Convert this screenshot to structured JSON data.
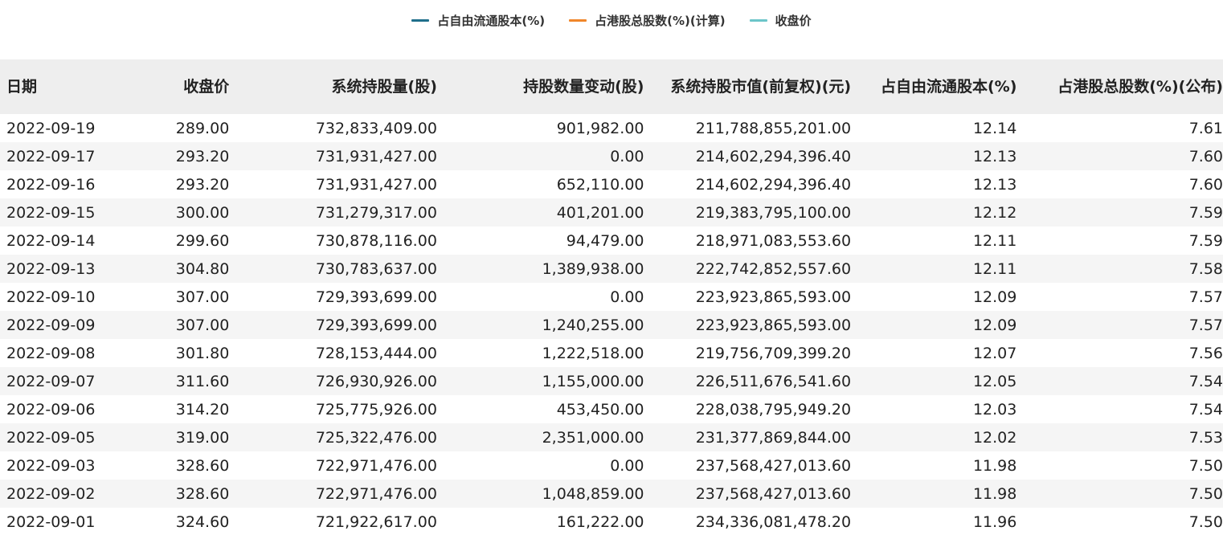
{
  "legend": {
    "items": [
      {
        "label": "占自由流通股本(%)",
        "color": "#1f6f8b"
      },
      {
        "label": "占港股总股数(%)(计算)",
        "color": "#f0862a"
      },
      {
        "label": "收盘价",
        "color": "#6cc5c9"
      }
    ]
  },
  "table": {
    "headers": {
      "date": "日期",
      "close": "收盘价",
      "holding": "系统持股量(股)",
      "change": "持股数量变动(股)",
      "value": "系统持股市值(前复权)(元)",
      "free_float": "占自由流通股本(%)",
      "hk_total": "占港股总股数(%)(公布)"
    },
    "rows": [
      {
        "date": "2022-09-19",
        "close": "289.00",
        "holding": "732,833,409.00",
        "change": "901,982.00",
        "value": "211,788,855,201.00",
        "free_float": "12.14",
        "hk_total": "7.61"
      },
      {
        "date": "2022-09-17",
        "close": "293.20",
        "holding": "731,931,427.00",
        "change": "0.00",
        "value": "214,602,294,396.40",
        "free_float": "12.13",
        "hk_total": "7.60"
      },
      {
        "date": "2022-09-16",
        "close": "293.20",
        "holding": "731,931,427.00",
        "change": "652,110.00",
        "value": "214,602,294,396.40",
        "free_float": "12.13",
        "hk_total": "7.60"
      },
      {
        "date": "2022-09-15",
        "close": "300.00",
        "holding": "731,279,317.00",
        "change": "401,201.00",
        "value": "219,383,795,100.00",
        "free_float": "12.12",
        "hk_total": "7.59"
      },
      {
        "date": "2022-09-14",
        "close": "299.60",
        "holding": "730,878,116.00",
        "change": "94,479.00",
        "value": "218,971,083,553.60",
        "free_float": "12.11",
        "hk_total": "7.59"
      },
      {
        "date": "2022-09-13",
        "close": "304.80",
        "holding": "730,783,637.00",
        "change": "1,389,938.00",
        "value": "222,742,852,557.60",
        "free_float": "12.11",
        "hk_total": "7.58"
      },
      {
        "date": "2022-09-10",
        "close": "307.00",
        "holding": "729,393,699.00",
        "change": "0.00",
        "value": "223,923,865,593.00",
        "free_float": "12.09",
        "hk_total": "7.57"
      },
      {
        "date": "2022-09-09",
        "close": "307.00",
        "holding": "729,393,699.00",
        "change": "1,240,255.00",
        "value": "223,923,865,593.00",
        "free_float": "12.09",
        "hk_total": "7.57"
      },
      {
        "date": "2022-09-08",
        "close": "301.80",
        "holding": "728,153,444.00",
        "change": "1,222,518.00",
        "value": "219,756,709,399.20",
        "free_float": "12.07",
        "hk_total": "7.56"
      },
      {
        "date": "2022-09-07",
        "close": "311.60",
        "holding": "726,930,926.00",
        "change": "1,155,000.00",
        "value": "226,511,676,541.60",
        "free_float": "12.05",
        "hk_total": "7.54"
      },
      {
        "date": "2022-09-06",
        "close": "314.20",
        "holding": "725,775,926.00",
        "change": "453,450.00",
        "value": "228,038,795,949.20",
        "free_float": "12.03",
        "hk_total": "7.54"
      },
      {
        "date": "2022-09-05",
        "close": "319.00",
        "holding": "725,322,476.00",
        "change": "2,351,000.00",
        "value": "231,377,869,844.00",
        "free_float": "12.02",
        "hk_total": "7.53"
      },
      {
        "date": "2022-09-03",
        "close": "328.60",
        "holding": "722,971,476.00",
        "change": "0.00",
        "value": "237,568,427,013.60",
        "free_float": "11.98",
        "hk_total": "7.50"
      },
      {
        "date": "2022-09-02",
        "close": "328.60",
        "holding": "722,971,476.00",
        "change": "1,048,859.00",
        "value": "237,568,427,013.60",
        "free_float": "11.98",
        "hk_total": "7.50"
      },
      {
        "date": "2022-09-01",
        "close": "324.60",
        "holding": "721,922,617.00",
        "change": "161,222.00",
        "value": "234,336,081,478.20",
        "free_float": "11.96",
        "hk_total": "7.50"
      }
    ]
  }
}
